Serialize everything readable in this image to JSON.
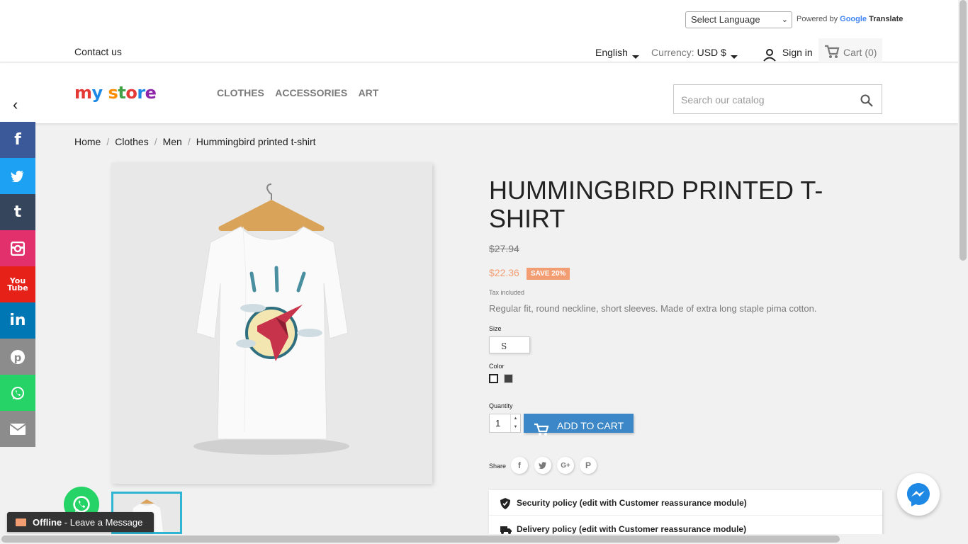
{
  "translate": {
    "select_label": "Select Language",
    "powered_by": "Powered by",
    "google": "Google",
    "translate": "Translate"
  },
  "header": {
    "contact": "Contact us",
    "language": "English",
    "currency_label": "Currency:",
    "currency_value": "USD $",
    "sign_in": "Sign in",
    "cart": "Cart (0)"
  },
  "nav": {
    "logo": "my store",
    "menu": [
      "CLOTHES",
      "ACCESSORIES",
      "ART"
    ],
    "search_placeholder": "Search our catalog"
  },
  "social": [
    {
      "name": "facebook-icon",
      "glyph": "f",
      "color": "#3b5998"
    },
    {
      "name": "twitter-icon",
      "glyph": "🐦",
      "color": "#1da1f2"
    },
    {
      "name": "tumblr-icon",
      "glyph": "t",
      "color": "#35465c"
    },
    {
      "name": "instagram-icon",
      "glyph": "◘",
      "color": "#e1306c"
    },
    {
      "name": "youtube-icon",
      "glyph": "▶",
      "color": "#e62117"
    },
    {
      "name": "linkedin-icon",
      "glyph": "in",
      "color": "#0077b5"
    },
    {
      "name": "pinterest-icon",
      "glyph": "P",
      "color": "#8c8c8c"
    },
    {
      "name": "whatsapp-icon",
      "glyph": "✆",
      "color": "#25d366"
    },
    {
      "name": "email-icon",
      "glyph": "✉",
      "color": "#8c8c8c"
    }
  ],
  "breadcrumb": [
    "Home",
    "Clothes",
    "Men",
    "Hummingbird printed t-shirt"
  ],
  "product": {
    "title": "HUMMINGBIRD PRINTED T-SHIRT",
    "old_price": "$27.94",
    "price": "$22.36",
    "discount": "SAVE 20%",
    "tax": "Tax included",
    "description": "Regular fit, round neckline, short sleeves. Made of extra long staple pima cotton.",
    "size_label": "Size",
    "size_value": "S",
    "color_label": "Color",
    "colors": [
      "#ffffff",
      "#434343"
    ],
    "quantity_label": "Quantity",
    "quantity": "1",
    "add_to_cart": "ADD TO CART",
    "share_label": "Share"
  },
  "reassurance": [
    "Security policy (edit with Customer reassurance module)",
    "Delivery policy (edit with Customer reassurance module)"
  ],
  "chat": {
    "status": "Offline",
    "message": " - Leave a Message"
  }
}
